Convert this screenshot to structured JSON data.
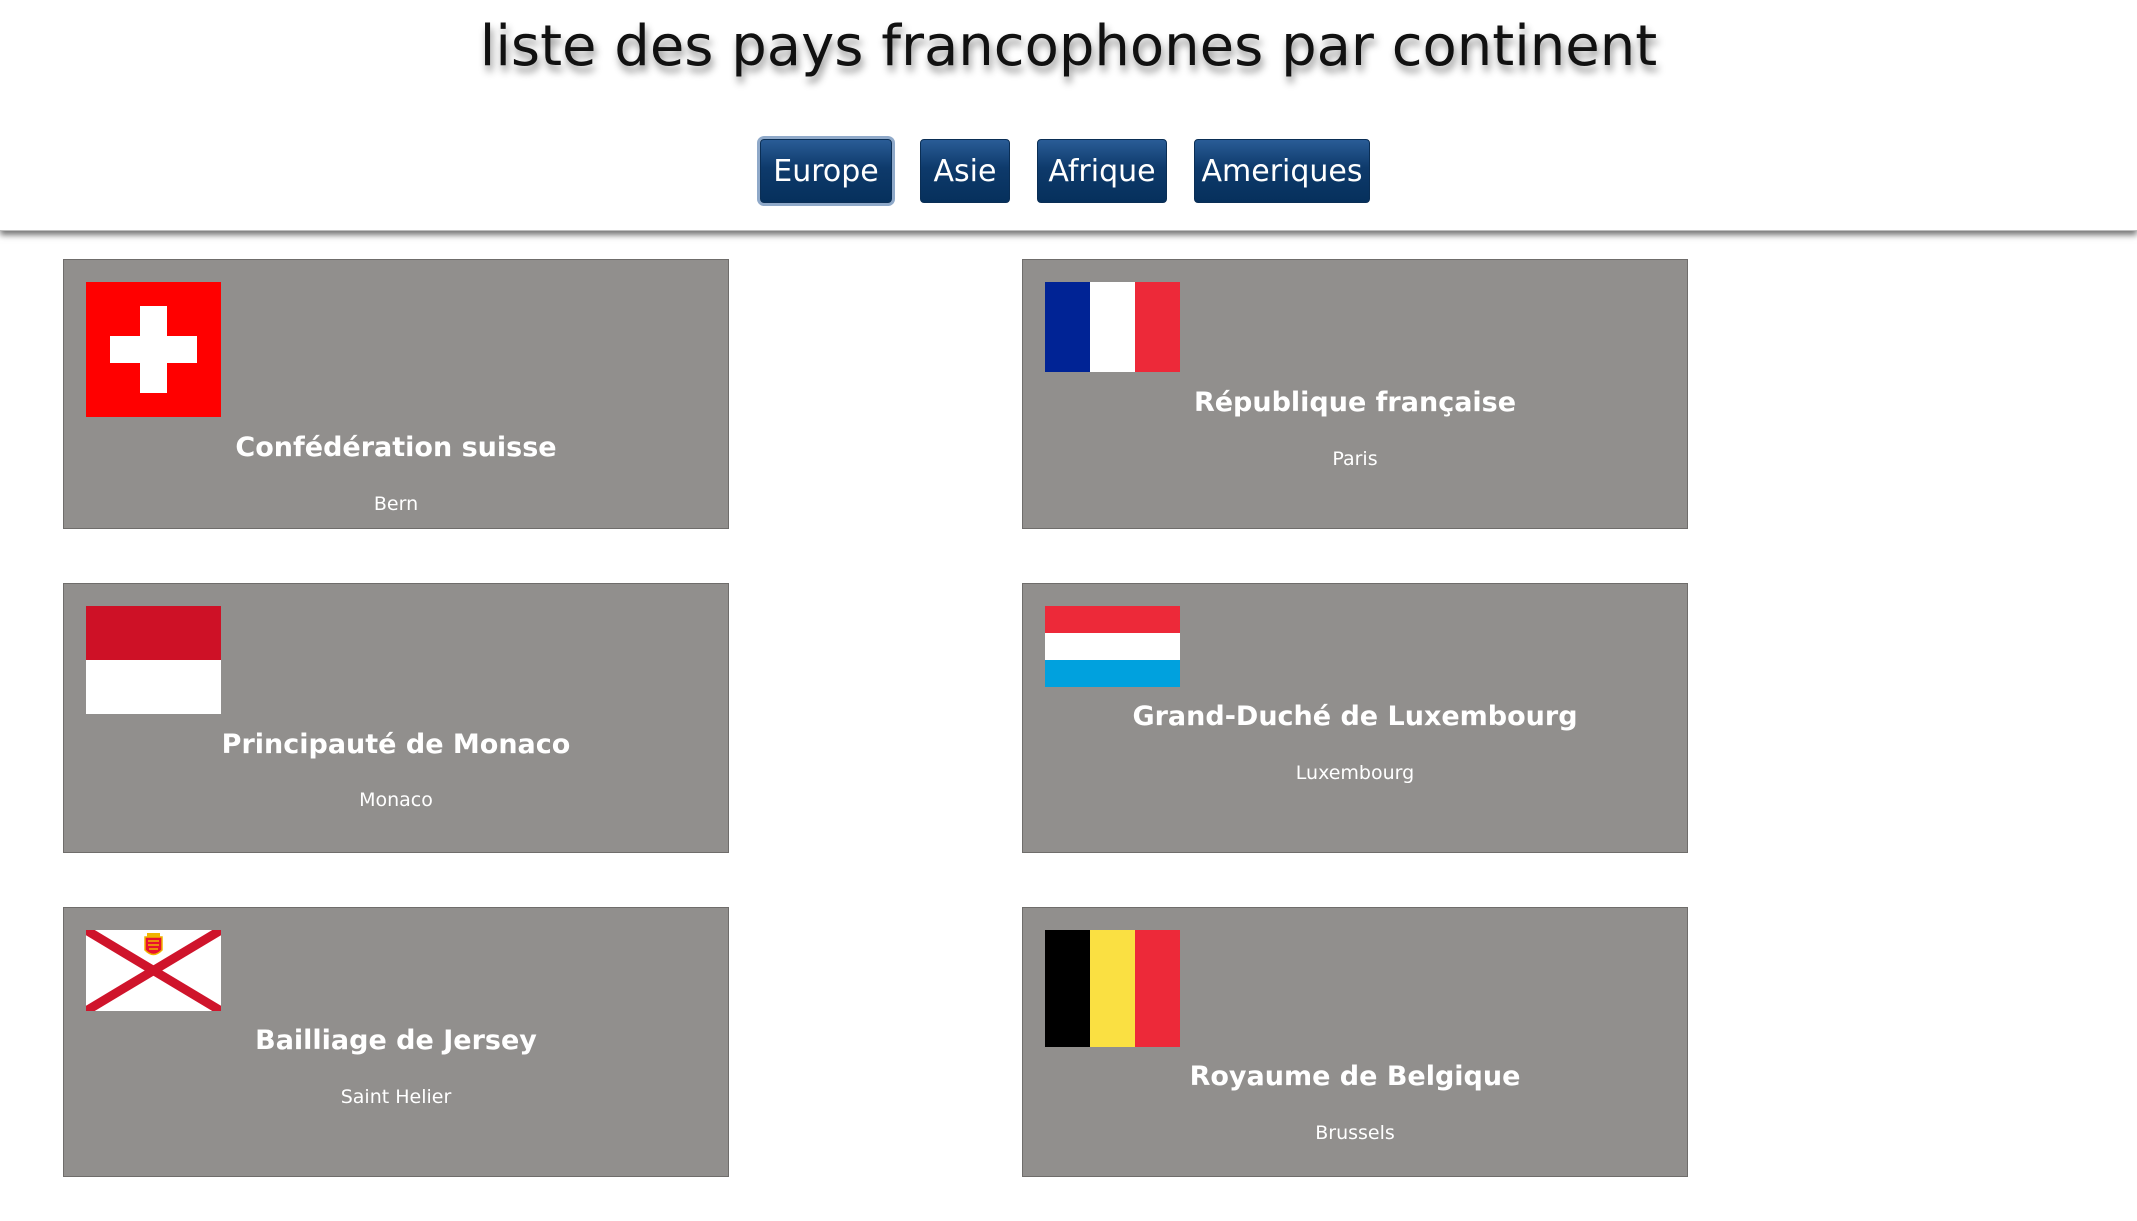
{
  "page": {
    "title": "liste des pays francophones par continent"
  },
  "tabs": [
    {
      "label": "Europe",
      "active": true
    },
    {
      "label": "Asie",
      "active": false
    },
    {
      "label": "Afrique",
      "active": false
    },
    {
      "label": "Ameriques",
      "active": false
    }
  ],
  "colors": {
    "tab_background": "#0e3a6b",
    "card_background": "#918f8d",
    "card_text": "#ffffff"
  },
  "countries": [
    {
      "name": "Confédération suisse",
      "capital": "Bern",
      "flag_icon": "switzerland-flag-icon"
    },
    {
      "name": "République française",
      "capital": "Paris",
      "flag_icon": "france-flag-icon"
    },
    {
      "name": "Principauté de Monaco",
      "capital": "Monaco",
      "flag_icon": "monaco-flag-icon"
    },
    {
      "name": "Grand-Duché de Luxembourg",
      "capital": "Luxembourg",
      "flag_icon": "luxembourg-flag-icon"
    },
    {
      "name": "Bailliage de Jersey",
      "capital": "Saint Helier",
      "flag_icon": "jersey-flag-icon"
    },
    {
      "name": "Royaume de Belgique",
      "capital": "Brussels",
      "flag_icon": "belgium-flag-icon"
    }
  ]
}
